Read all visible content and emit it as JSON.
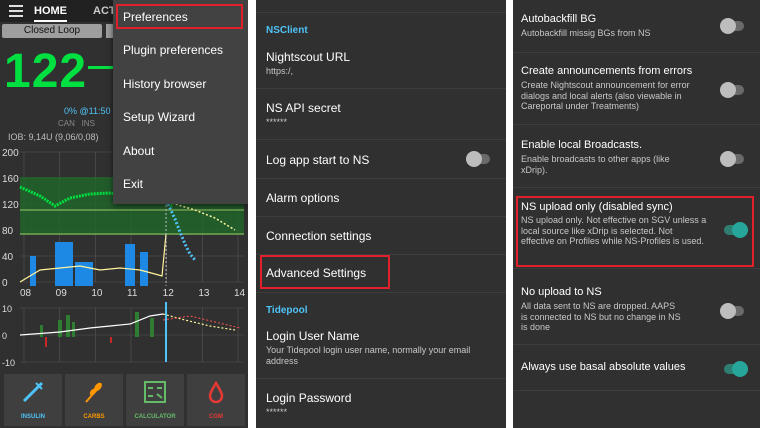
{
  "panel1": {
    "tabs": [
      "HOME",
      "ACT"
    ],
    "loop_button": "Closed Loop",
    "bg_value": "122",
    "temp_basal": "0% @11:50",
    "can_ins": [
      "CAN",
      "INS"
    ],
    "iob": "IOB: 9,14U (9,06/0,08)",
    "menu": [
      "Preferences",
      "Plugin preferences",
      "History browser",
      "Setup Wizard",
      "About",
      "Exit"
    ],
    "bottom_buttons": [
      {
        "label": "INSULIN",
        "color": "#4fc3f7",
        "icon": "syringe-icon"
      },
      {
        "label": "CARBS",
        "color": "#ff9800",
        "icon": "wheat-icon"
      },
      {
        "label": "CALCULATOR",
        "color": "#66bb6a",
        "icon": "calculator-icon"
      },
      {
        "label": "CGM",
        "color": "#e53935",
        "icon": "blood-drop-icon"
      }
    ],
    "chart_data": [
      {
        "type": "line",
        "y_ticks": [
          "200",
          "160",
          "120",
          "80",
          "40",
          "0"
        ],
        "x_ticks": [
          "08",
          "09",
          "10",
          "11",
          "12",
          "13",
          "14"
        ],
        "ylim": [
          0,
          200
        ]
      },
      {
        "type": "line",
        "y_ticks": [
          "10",
          "0",
          "-10"
        ],
        "ylim": [
          -10,
          10
        ]
      }
    ]
  },
  "panel2": {
    "category_nsclient": "NSClient",
    "nightscout_url_title": "Nightscout URL",
    "nightscout_url_value": "https:/,",
    "api_secret_title": "NS API secret",
    "api_secret_value": "******",
    "log_app_start": "Log app start to NS",
    "alarm_options": "Alarm options",
    "connection_settings": "Connection settings",
    "advanced_settings": "Advanced Settings",
    "category_tidepool": "Tidepool",
    "login_user_title": "Login User Name",
    "login_user_desc": "Your Tidepool login user name, normally your email address",
    "login_password_title": "Login Password",
    "login_password_value": "******"
  },
  "panel3": {
    "items": [
      {
        "title": "Autobackfill BG",
        "desc": "Autobackfill missig BGs from NS",
        "on": false
      },
      {
        "title": "Create announcements from errors",
        "desc": "Create Nightscout announcement for error dialogs and local alerts (also viewable in Careportal under Treatments)",
        "on": false
      },
      {
        "title": "Enable local Broadcasts.",
        "desc": "Enable broadcasts to other apps (like xDrip).",
        "on": false
      },
      {
        "title": "NS upload only (disabled sync)",
        "desc": "NS upload only. Not effective on SGV unless a local source like xDrip is selected. Not effective on Profiles while NS-Profiles is used.",
        "on": true
      },
      {
        "title": "No upload to NS",
        "desc": "All data sent to NS are dropped. AAPS is connected to NS but no change in NS is done",
        "on": false
      },
      {
        "title": "Always use basal absolute values",
        "desc": "",
        "on": true
      }
    ]
  },
  "colors": {
    "highlight": "#e0202a",
    "bg_green": "#00e040",
    "accent": "#26a69a",
    "category": "#4fc3f7"
  }
}
